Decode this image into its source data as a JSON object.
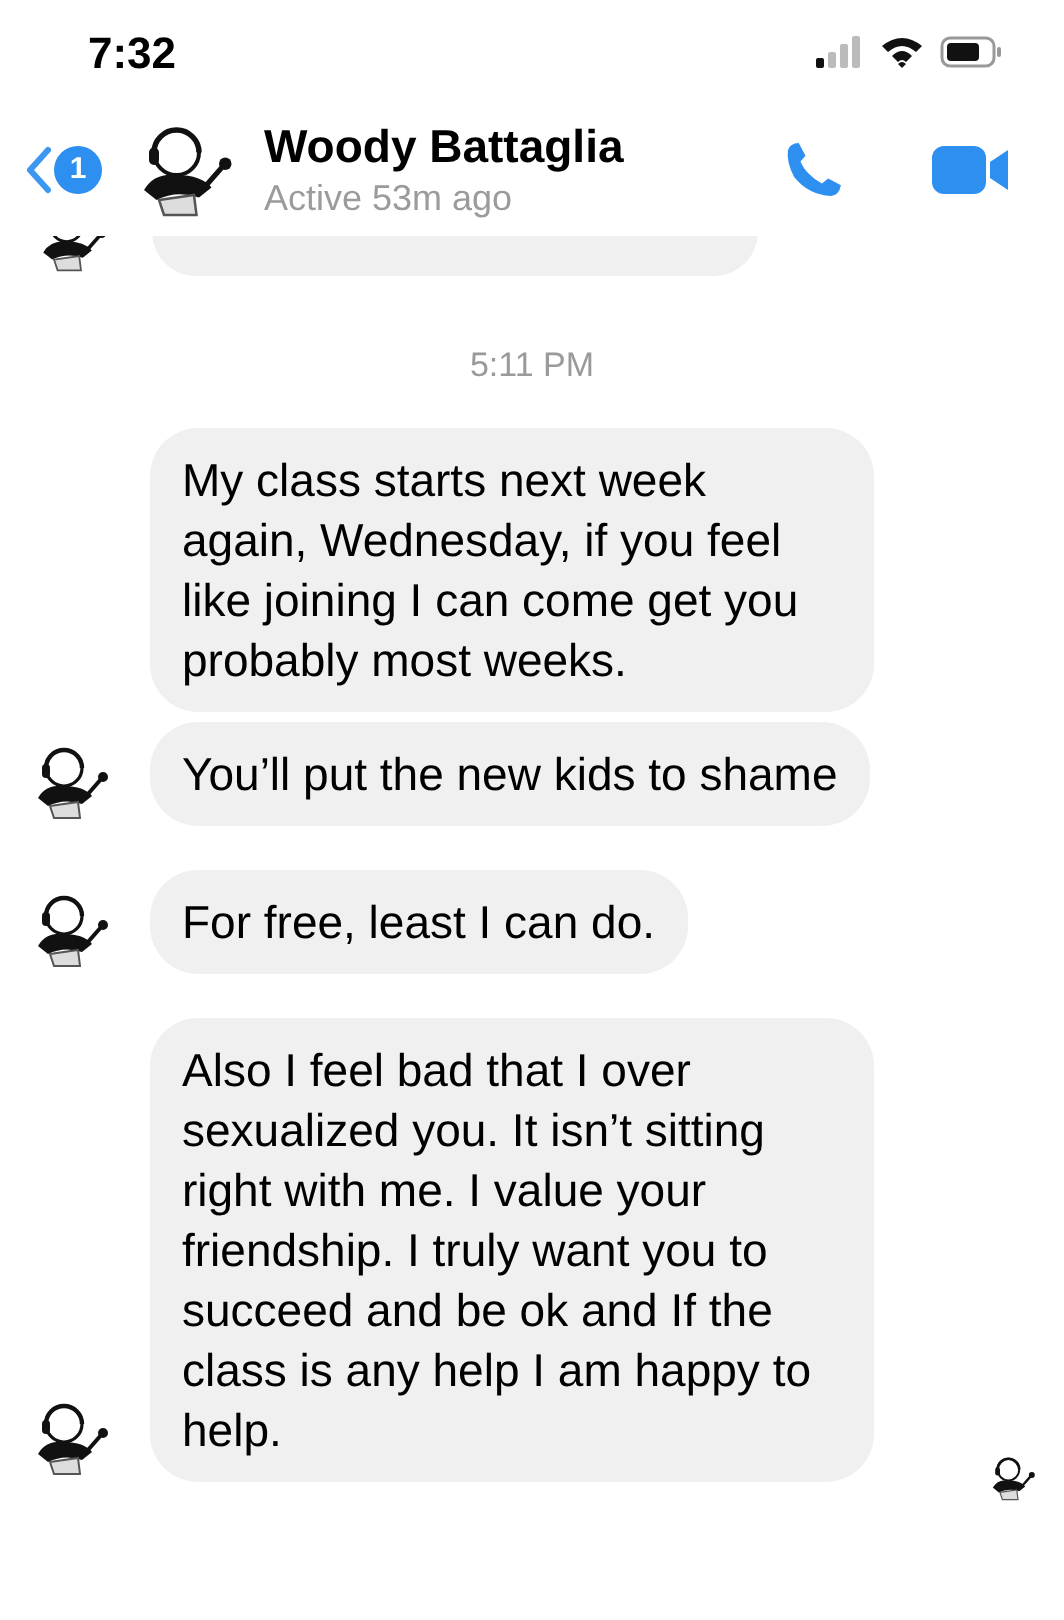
{
  "status_bar": {
    "time": "7:32"
  },
  "header": {
    "unread_count": "1",
    "name": "Woody Battaglia",
    "status": "Active 53m ago"
  },
  "timestamp": "5:11 PM",
  "message_groups": [
    {
      "messages": [
        {
          "text": "My class starts next week again, Wednesday, if you feel like joining I can come get you probably most weeks.",
          "avatar": false
        },
        {
          "text": "You’ll put the new kids to shame",
          "avatar": true
        }
      ]
    },
    {
      "messages": [
        {
          "text": "For free, least I can do.",
          "avatar": true
        }
      ]
    },
    {
      "messages": [
        {
          "text": "Also I feel bad that I over sexualized you. It isn’t sitting right with me. I value your friendship. I truly want you to succeed and be ok and If the class is any help I am happy to help.",
          "avatar": true
        }
      ]
    }
  ],
  "read_receipt": true
}
